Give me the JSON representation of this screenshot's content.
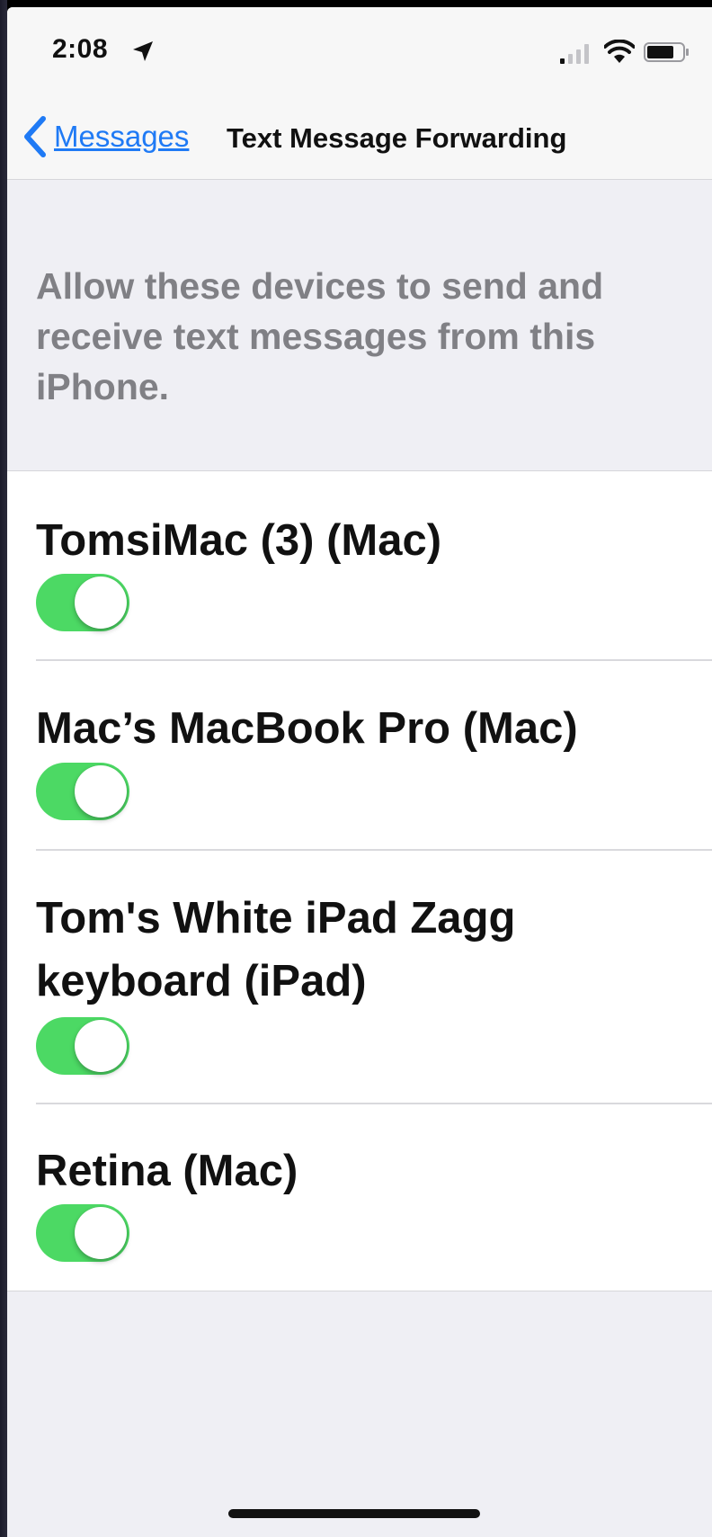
{
  "status_bar": {
    "time": "2:08",
    "location_icon": "location-arrow-icon",
    "signal_icon": "cellular-signal-icon",
    "wifi_icon": "wifi-icon",
    "battery_icon": "battery-icon"
  },
  "nav": {
    "back_label": "Messages",
    "back_icon": "chevron-left-icon",
    "title": "Text Message Forwarding"
  },
  "description": "Allow these devices to send and receive text messages from this iPhone.",
  "devices": [
    {
      "name": "TomsiMac (3) (Mac)",
      "enabled": true
    },
    {
      "name": "Mac’s MacBook Pro (Mac)",
      "enabled": true
    },
    {
      "name": "Tom's White iPad Zagg keyboard (iPad)",
      "enabled": true
    },
    {
      "name": "Retina (Mac)",
      "enabled": true
    }
  ],
  "colors": {
    "accent": "#1f7af5",
    "toggle_on": "#4cd964",
    "background": "#efeff4",
    "footer_text": "#808085"
  }
}
